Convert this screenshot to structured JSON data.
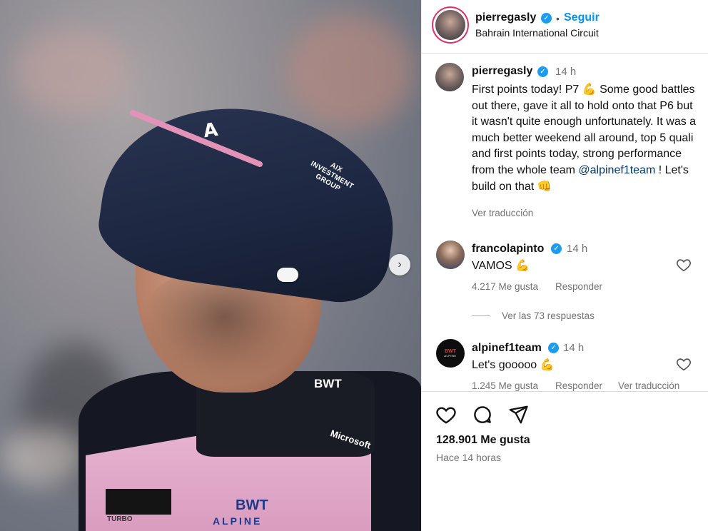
{
  "post": {
    "photo_sponsors": {
      "cap_logo": "A",
      "cap_text": "AIX INVESTMENT GROUP",
      "collar_bwt": "BWT",
      "chest_microsoft": "Microsoft",
      "chest_bwt": "BWT",
      "chest_alpine": "ALPINE",
      "sleeve": "TURBO"
    },
    "carousel_next": "›"
  },
  "header": {
    "username": "pierregasly",
    "verified_glyph": "✓",
    "separator": "•",
    "follow_label": "Seguir",
    "location": "Bahrain International Circuit"
  },
  "caption": {
    "username": "pierregasly",
    "time": "14 h",
    "text_part1": "First points today! P7 ",
    "emoji1": "💪",
    "text_part2": " Some good battles out there, gave it all to hold onto that P6 but it wasn't quite enough unfortunately. It was a much better weekend all around, top 5 quali and first points today, strong performance from the whole team ",
    "mention": "@alpinef1team",
    "text_part3": " ! Let's build on that ",
    "emoji2": "👊",
    "translate": "Ver traducción"
  },
  "comments": [
    {
      "username": "francolapinto",
      "time": "14 h",
      "text": "VAMOS 💪",
      "likes": "4.217 Me gusta",
      "reply": "Responder"
    },
    {
      "username": "alpinef1team",
      "time": "14 h",
      "text": "Let's gooooo 💪",
      "likes": "1.245 Me gusta",
      "reply": "Responder",
      "translate": "Ver traducción"
    }
  ],
  "replies_toggle": "Ver las 73 respuestas",
  "avatar_alpine": {
    "bwt": "BWT",
    "alpine": "ALPINE"
  },
  "footer": {
    "likes": "128.901 Me gusta",
    "posted": "Hace 14 horas"
  },
  "colors": {
    "accent_blue": "#0095f6",
    "verified": "#1d9bf0",
    "mention": "#00376b",
    "muted": "#737373"
  }
}
